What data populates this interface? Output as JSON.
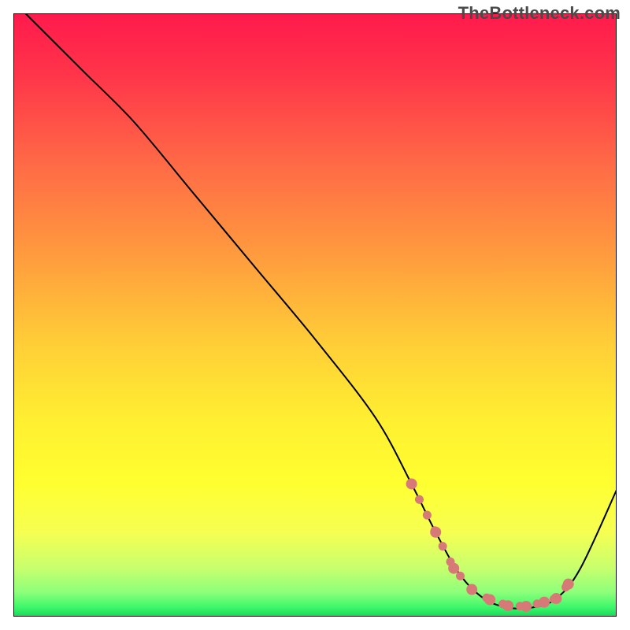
{
  "watermark": "TheBottleneck.com",
  "chart_data": {
    "type": "line",
    "title": "",
    "xlabel": "",
    "ylabel": "",
    "xlim": [
      0,
      100
    ],
    "ylim": [
      0,
      100
    ],
    "grid": false,
    "legend": false,
    "annotations": [],
    "series": [
      {
        "name": "bottleneck-curve",
        "color": "#000000",
        "x": [
          2,
          6,
          12,
          20,
          30,
          40,
          50,
          60,
          66,
          70,
          74,
          78,
          82,
          86,
          90,
          94,
          100
        ],
        "y": [
          100,
          96,
          90,
          82,
          70,
          58,
          46,
          33,
          22,
          14,
          7,
          3,
          1.5,
          1.5,
          3,
          8,
          21
        ]
      },
      {
        "name": "optimal-zone",
        "color": "#d77a77",
        "style": "dots",
        "x": [
          66,
          70,
          73,
          76,
          79,
          82,
          85,
          88,
          90,
          92
        ],
        "y": [
          22,
          14,
          8,
          4.5,
          2.8,
          1.8,
          1.7,
          2.4,
          3.0,
          5.4
        ]
      }
    ],
    "background_gradient": {
      "stops": [
        {
          "offset": 0.0,
          "color": "#ff1a4c"
        },
        {
          "offset": 0.1,
          "color": "#ff344a"
        },
        {
          "offset": 0.25,
          "color": "#ff6a46"
        },
        {
          "offset": 0.4,
          "color": "#ff9b3e"
        },
        {
          "offset": 0.55,
          "color": "#ffcf37"
        },
        {
          "offset": 0.68,
          "color": "#fff031"
        },
        {
          "offset": 0.78,
          "color": "#ffff30"
        },
        {
          "offset": 0.86,
          "color": "#f6ff52"
        },
        {
          "offset": 0.92,
          "color": "#c7ff6e"
        },
        {
          "offset": 0.96,
          "color": "#8cff7a"
        },
        {
          "offset": 0.985,
          "color": "#3cf76a"
        },
        {
          "offset": 1.0,
          "color": "#18d657"
        }
      ]
    }
  }
}
